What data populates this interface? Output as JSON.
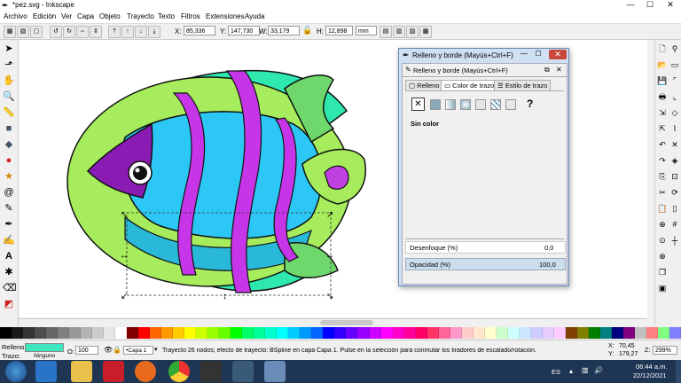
{
  "window": {
    "title": "*pez.svg - Inkscape",
    "min": "—",
    "max": "☐",
    "close": "✕"
  },
  "menu": [
    "Archivo",
    "Edición",
    "Ver",
    "Capa",
    "Objeto",
    "Trayecto",
    "Texto",
    "Filtros",
    "Extensiones",
    "Ayuda"
  ],
  "toolbar": {
    "x_label": "X:",
    "x": "85,336",
    "y_label": "Y:",
    "y": "147,730",
    "w_label": "W:",
    "w": "33,179",
    "h_label": "H:",
    "h": "12,898",
    "unit": "mm"
  },
  "dialog": {
    "title": "Relleno y borde (Mayús+Ctrl+F)",
    "panel_title": "Relleno y borde (Mayús+Ctrl+F)",
    "tabs": [
      "Relleno",
      "Color de trazo",
      "Estilo de trazo"
    ],
    "no_color": "Sin color",
    "blur_label": "Desenfoque (%)",
    "blur_value": "0,0",
    "opacity_label": "Opacidad (%)",
    "opacity_value": "100,0"
  },
  "status": {
    "fill_label": "Relleno:",
    "stroke_label": "Trazo:",
    "stroke_value": "Ninguno",
    "opacity_label": "O:",
    "opacity_value": "100",
    "layer": "•Capa 1",
    "message": "Trayecto 26 nodos; efecto de trayecto: BSpline en capa Capa 1. Pulse en la selección para conmutar los tiradores de escalado/rotación.",
    "message_bold": "Trayecto",
    "message_bold2": "Capa 1",
    "x_label": "X:",
    "x": "70,45",
    "y_label": "Y:",
    "y": "179,27",
    "zoom_label": "Z:",
    "zoom": "299%",
    "fill_color": "#3ee6c0"
  },
  "taskbar": {
    "lang": "ES",
    "time": "06:44 a.m.",
    "date": "22/12/2021"
  },
  "palette": [
    "#000000",
    "#1a1a1a",
    "#333333",
    "#4d4d4d",
    "#666666",
    "#808080",
    "#999999",
    "#b3b3b3",
    "#cccccc",
    "#e6e6e6",
    "#ffffff",
    "#800000",
    "#ff0000",
    "#ff6600",
    "#ff9900",
    "#ffcc00",
    "#ffff00",
    "#ccff00",
    "#99ff00",
    "#66ff00",
    "#00ff00",
    "#00ff66",
    "#00ff99",
    "#00ffcc",
    "#00ffff",
    "#00ccff",
    "#0099ff",
    "#0066ff",
    "#0000ff",
    "#3300ff",
    "#6600ff",
    "#9900ff",
    "#cc00ff",
    "#ff00ff",
    "#ff00cc",
    "#ff0099",
    "#ff0066",
    "#ff3366",
    "#ff6699",
    "#ff99cc",
    "#ffcccc",
    "#ffe6cc",
    "#ffffcc",
    "#ccffcc",
    "#ccffff",
    "#cce6ff",
    "#ccccff",
    "#e6ccff",
    "#ffccff",
    "#804000",
    "#808000",
    "#008000",
    "#008080",
    "#000080",
    "#800080",
    "#c0c0c0",
    "#ff8080",
    "#80ff80",
    "#8080ff"
  ]
}
